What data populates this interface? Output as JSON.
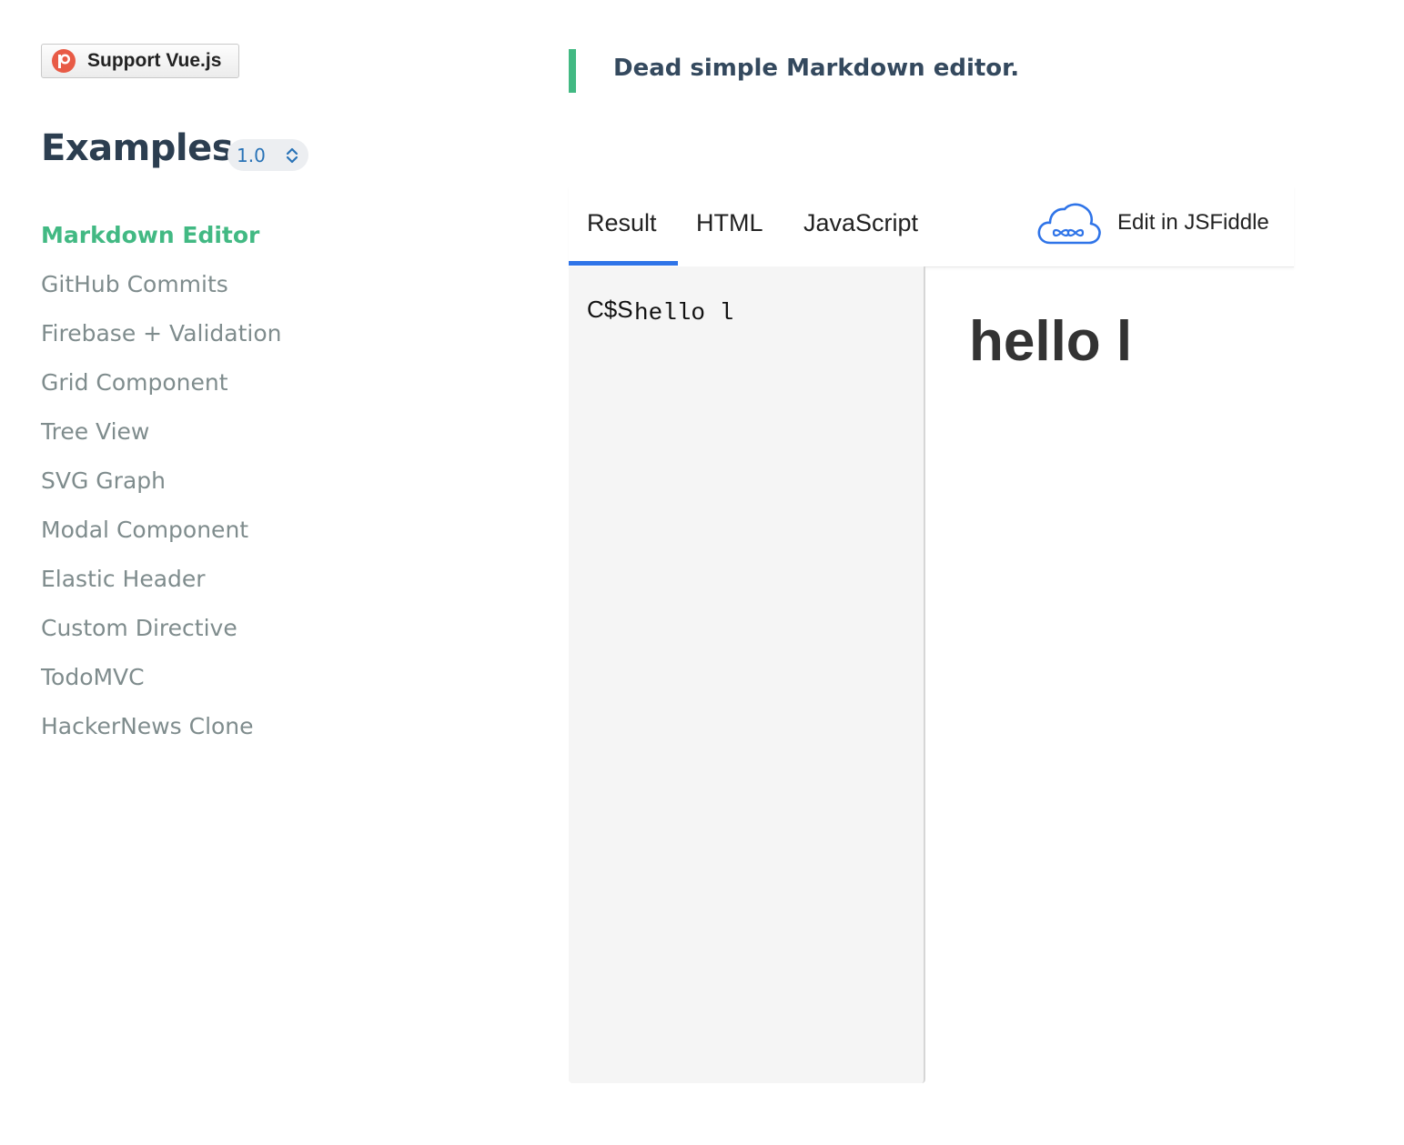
{
  "sponsor": {
    "label": "Support Vue.js",
    "icon": "patreon-icon"
  },
  "sidebar": {
    "title": "Examples",
    "version": "1.0",
    "items": [
      {
        "label": "Markdown Editor",
        "active": true
      },
      {
        "label": "GitHub Commits",
        "active": false
      },
      {
        "label": "Firebase + Validation",
        "active": false
      },
      {
        "label": "Grid Component",
        "active": false
      },
      {
        "label": "Tree View",
        "active": false
      },
      {
        "label": "SVG Graph",
        "active": false
      },
      {
        "label": "Modal Component",
        "active": false
      },
      {
        "label": "Elastic Header",
        "active": false
      },
      {
        "label": "Custom Directive",
        "active": false
      },
      {
        "label": "TodoMVC",
        "active": false
      },
      {
        "label": "HackerNews Clone",
        "active": false
      }
    ]
  },
  "main": {
    "description": "Dead simple Markdown editor."
  },
  "fiddle": {
    "tabs": [
      {
        "label": "Result",
        "active": true
      },
      {
        "label": "HTML",
        "active": false
      },
      {
        "label": "JavaScript",
        "active": false
      }
    ],
    "edit_label": "Edit in JSFiddle",
    "edit_icon": "cloud-icon",
    "editor": {
      "overlap_glyphs": "C$S",
      "value": "hello l"
    },
    "preview": {
      "heading": "hello l"
    }
  },
  "colors": {
    "accent_green": "#42b983",
    "tab_blue": "#2f74e8",
    "nav_gray": "#7f8c8d",
    "title_dark": "#2c3e50",
    "version_blue": "#2973b7"
  }
}
